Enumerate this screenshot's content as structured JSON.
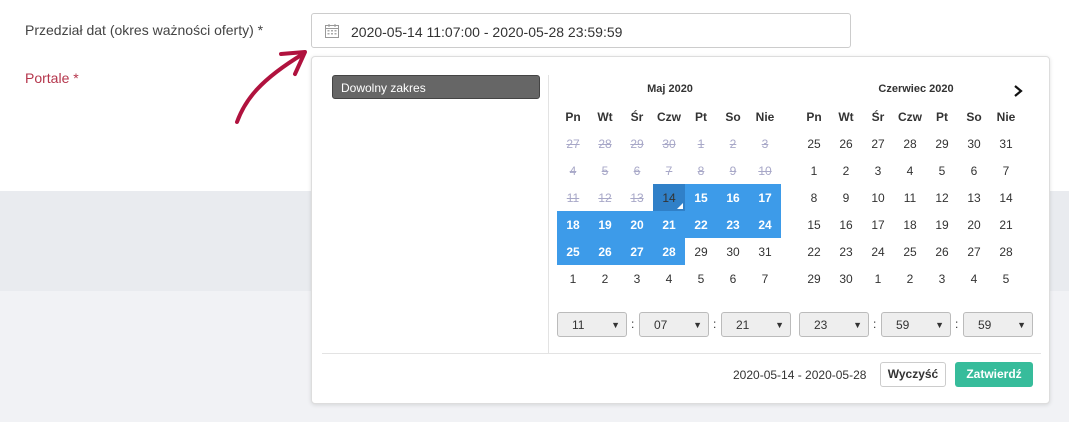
{
  "form": {
    "date_range_label": "Przedział dat (okres ważności oferty) *",
    "portals_label": "Portale *",
    "date_range_value": "2020-05-14 11:07:00 - 2020-05-28 23:59:59"
  },
  "picker": {
    "preset_label": "Dowolny zakres",
    "weekdays": [
      "Pn",
      "Wt",
      "Śr",
      "Czw",
      "Pt",
      "So",
      "Nie"
    ],
    "left_month": {
      "title": "Maj 2020",
      "weeks": [
        [
          "27",
          "28",
          "29",
          "30",
          "1",
          "2",
          "3"
        ],
        [
          "4",
          "5",
          "6",
          "7",
          "8",
          "9",
          "10"
        ],
        [
          "11",
          "12",
          "13",
          "14",
          "15",
          "16",
          "17"
        ],
        [
          "18",
          "19",
          "20",
          "21",
          "22",
          "23",
          "24"
        ],
        [
          "25",
          "26",
          "27",
          "28",
          "29",
          "30",
          "31"
        ],
        [
          "1",
          "2",
          "3",
          "4",
          "5",
          "6",
          "7"
        ]
      ]
    },
    "right_month": {
      "title": "Czerwiec 2020",
      "weeks": [
        [
          "25",
          "26",
          "27",
          "28",
          "29",
          "30",
          "31"
        ],
        [
          "1",
          "2",
          "3",
          "4",
          "5",
          "6",
          "7"
        ],
        [
          "8",
          "9",
          "10",
          "11",
          "12",
          "13",
          "14"
        ],
        [
          "15",
          "16",
          "17",
          "18",
          "19",
          "20",
          "21"
        ],
        [
          "22",
          "23",
          "24",
          "25",
          "26",
          "27",
          "28"
        ],
        [
          "29",
          "30",
          "1",
          "2",
          "3",
          "4",
          "5"
        ]
      ]
    },
    "start_time": {
      "hour": "11",
      "minute": "07",
      "second": "21"
    },
    "end_time": {
      "hour": "23",
      "minute": "59",
      "second": "59"
    },
    "footer_range": "2020-05-14 - 2020-05-28",
    "clear_label": "Wyczyść",
    "confirm_label": "Zatwierdź",
    "icons": {
      "calendar": "calendar-icon",
      "next": "chevron-right-icon"
    },
    "colors": {
      "selection": "#3d9be9",
      "confirm": "#37bc9b",
      "required_label": "#b5364c",
      "arrow": "#b0123e"
    }
  }
}
